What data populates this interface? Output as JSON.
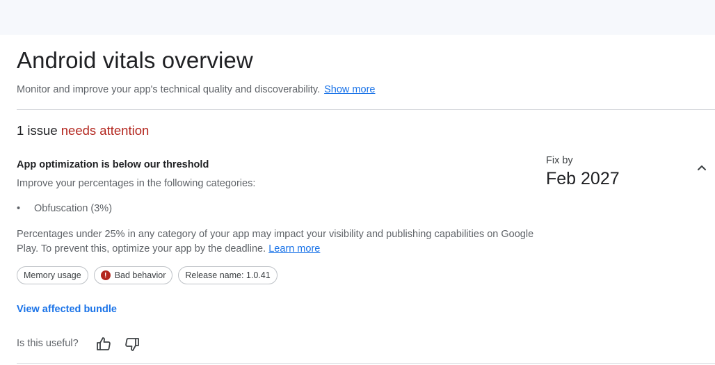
{
  "header": {
    "title": "Android vitals overview",
    "subtitle": "Monitor and improve your app's technical quality and discoverability.",
    "show_more": "Show more"
  },
  "issues": {
    "count_text": "1 issue",
    "status_text": "needs attention"
  },
  "issue": {
    "title": "App optimization is below our threshold",
    "description": "Improve your percentages in the following categories:",
    "bullet_item": "Obfuscation (3%)",
    "paragraph": "Percentages under 25% in any category of your app may impact your visibility and publishing capabilities on Google Play. To prevent this, optimize your app by the deadline.",
    "learn_more": "Learn more",
    "chips": {
      "memory": "Memory usage",
      "behavior": "Bad behavior",
      "behavior_icon": "!",
      "release": "Release name: 1.0.41"
    },
    "view_bundle": "View affected bundle",
    "fix_by_label": "Fix by",
    "fix_by_date": "Feb 2027"
  },
  "feedback": {
    "question": "Is this useful?"
  },
  "icons": {
    "thumbs_up": "thumbs-up-icon",
    "thumbs_down": "thumbs-down-icon",
    "collapse": "chevron-up-icon",
    "error": "error-icon"
  },
  "colors": {
    "attention": "#b3261e",
    "link": "#1a73e8",
    "top_band": "#f6f8fc"
  }
}
